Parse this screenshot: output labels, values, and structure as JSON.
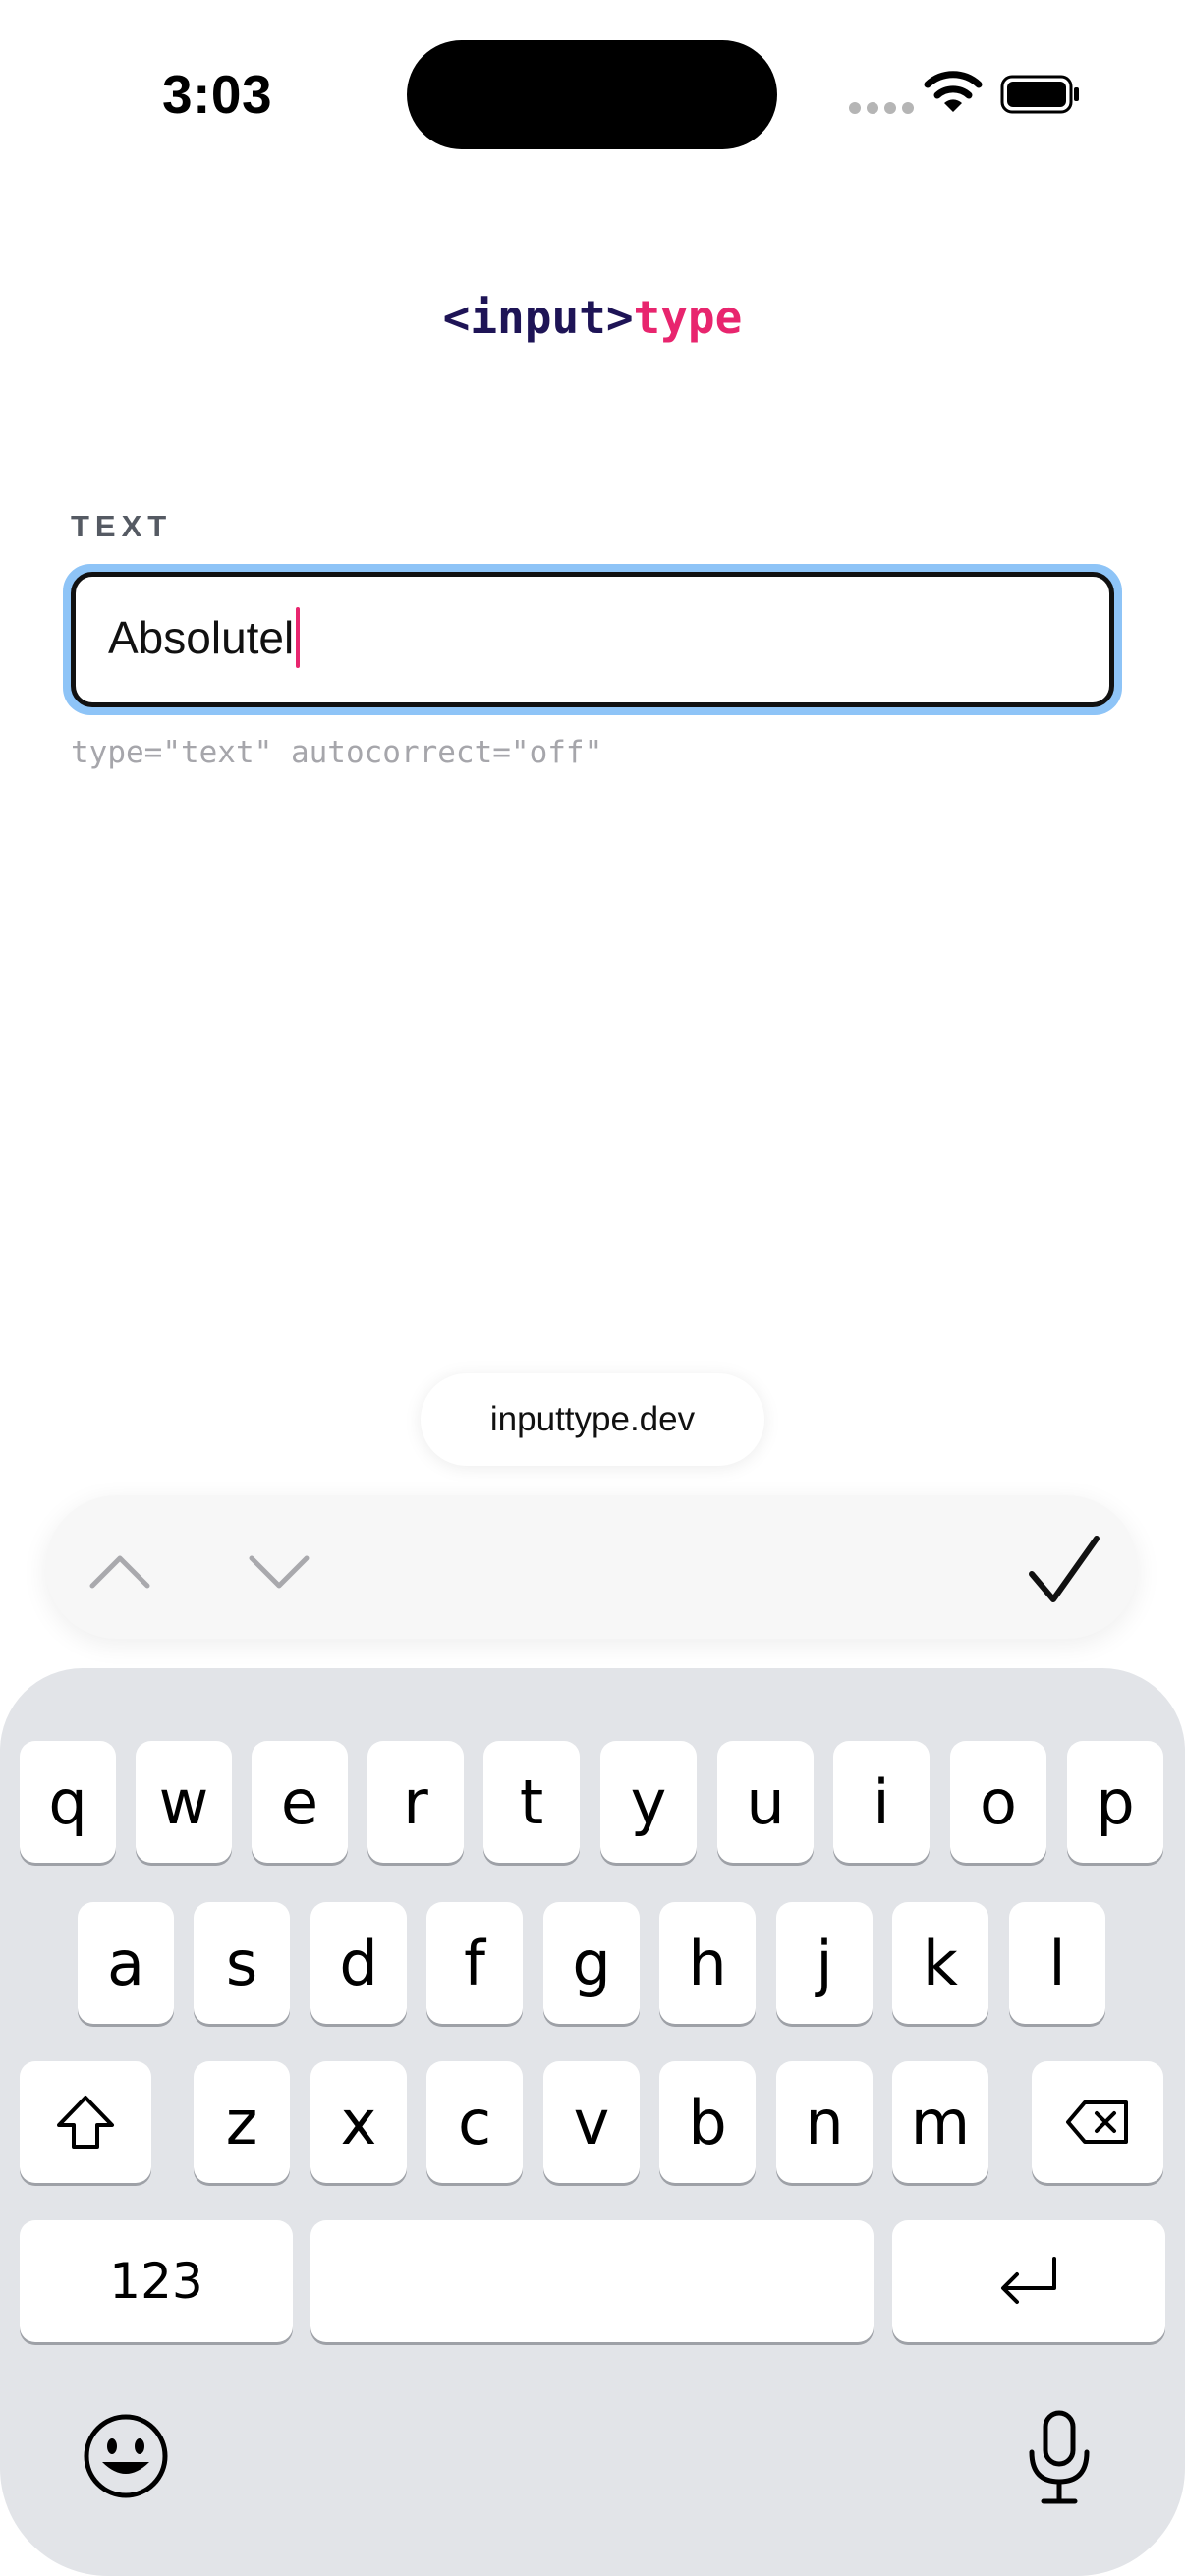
{
  "status_bar": {
    "time": "3:03",
    "icons": [
      "signal-dots-icon",
      "wifi-icon",
      "battery-icon"
    ]
  },
  "logo": {
    "part1": "<input>",
    "part2": "type"
  },
  "form": {
    "label": "TEXT",
    "value": "Absolutel",
    "hint": "type=\"text\" autocorrect=\"off\""
  },
  "domain_pill": "inputtype.dev",
  "toolbar": {
    "icons": [
      "chevron-up-icon",
      "chevron-down-icon",
      "checkmark-icon"
    ]
  },
  "keyboard": {
    "row1": [
      "q",
      "w",
      "e",
      "r",
      "t",
      "y",
      "u",
      "i",
      "o",
      "p"
    ],
    "row2": [
      "a",
      "s",
      "d",
      "f",
      "g",
      "h",
      "j",
      "k",
      "l"
    ],
    "row3": [
      "z",
      "x",
      "c",
      "v",
      "b",
      "n",
      "m"
    ],
    "numbers_key": "123",
    "icons": [
      "shift-icon",
      "delete-icon",
      "return-icon",
      "emoji-icon",
      "microphone-icon"
    ]
  },
  "colors": {
    "accent_pink": "#e8256e",
    "logo_navy": "#1e1456",
    "focus_ring": "#8ec4f7",
    "keyboard_bg": "#e2e4e8"
  }
}
